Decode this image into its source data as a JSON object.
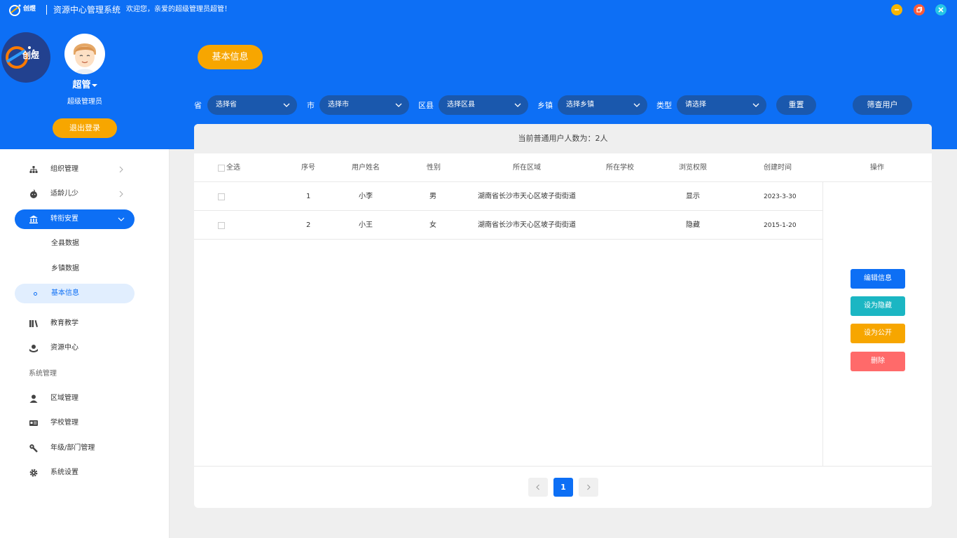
{
  "titlebar": {
    "logo_text": "创煜",
    "app_name": "资源中心管理系统",
    "welcome": "欢迎您，亲爱的超级管理员超管！"
  },
  "user": {
    "name": "超管",
    "role": "超级管理员",
    "logout_label": "退出登录"
  },
  "sidebar": {
    "items": [
      {
        "label": "组织管理",
        "icon": "org-icon"
      },
      {
        "label": "适龄儿少",
        "icon": "child-icon"
      },
      {
        "label": "转衔安置",
        "icon": "bank-icon",
        "active": true
      },
      {
        "label": "全县数据"
      },
      {
        "label": "乡镇数据"
      },
      {
        "label": "基本信息",
        "selected": true
      },
      {
        "label": "教育教学",
        "icon": "books-icon"
      },
      {
        "label": "资源中心",
        "icon": "resource-icon"
      },
      {
        "label": "区域管理",
        "icon": "user-icon"
      },
      {
        "label": "学校管理",
        "icon": "id-card-icon"
      },
      {
        "label": "年级/部门管理",
        "icon": "wrench-icon"
      },
      {
        "label": "系统设置",
        "icon": "gear-icon"
      }
    ],
    "section_label": "系统管理"
  },
  "header": {
    "page_tag": "基本信息"
  },
  "filters": {
    "province": {
      "label": "省",
      "value": "选择省"
    },
    "city": {
      "label": "市",
      "value": "选择市"
    },
    "county": {
      "label": "区县",
      "value": "选择区县"
    },
    "town": {
      "label": "乡镇",
      "value": "选择乡镇"
    },
    "type": {
      "label": "类型",
      "value": "请选择"
    },
    "reset_label": "重置",
    "filter_label": "筛查用户"
  },
  "table": {
    "summary": "当前普通用户人数为：2人",
    "columns": [
      "全选",
      "序号",
      "用户姓名",
      "性别",
      "所在区域",
      "所在学校",
      "浏览权限",
      "创建时间",
      "操作"
    ],
    "rows": [
      {
        "index": "1",
        "name": "小李",
        "gender": "男",
        "region": "湖南省长沙市天心区坡子街街道",
        "school": "",
        "permission": "显示",
        "created": "2023-3-30"
      },
      {
        "index": "2",
        "name": "小王",
        "gender": "女",
        "region": "湖南省长沙市天心区坡子街街道",
        "school": "",
        "permission": "隐藏",
        "created": "2015-1-20"
      }
    ],
    "actions": {
      "edit": "编辑信息",
      "hide": "设为隐藏",
      "public": "设为公开",
      "delete": "删除"
    }
  },
  "pagination": {
    "current": "1"
  },
  "colors": {
    "primary": "#0d6ff5",
    "select_bg": "#1a58ad",
    "orange": "#f7a600",
    "teal": "#1bb6c3",
    "red": "#ff6a6a"
  }
}
